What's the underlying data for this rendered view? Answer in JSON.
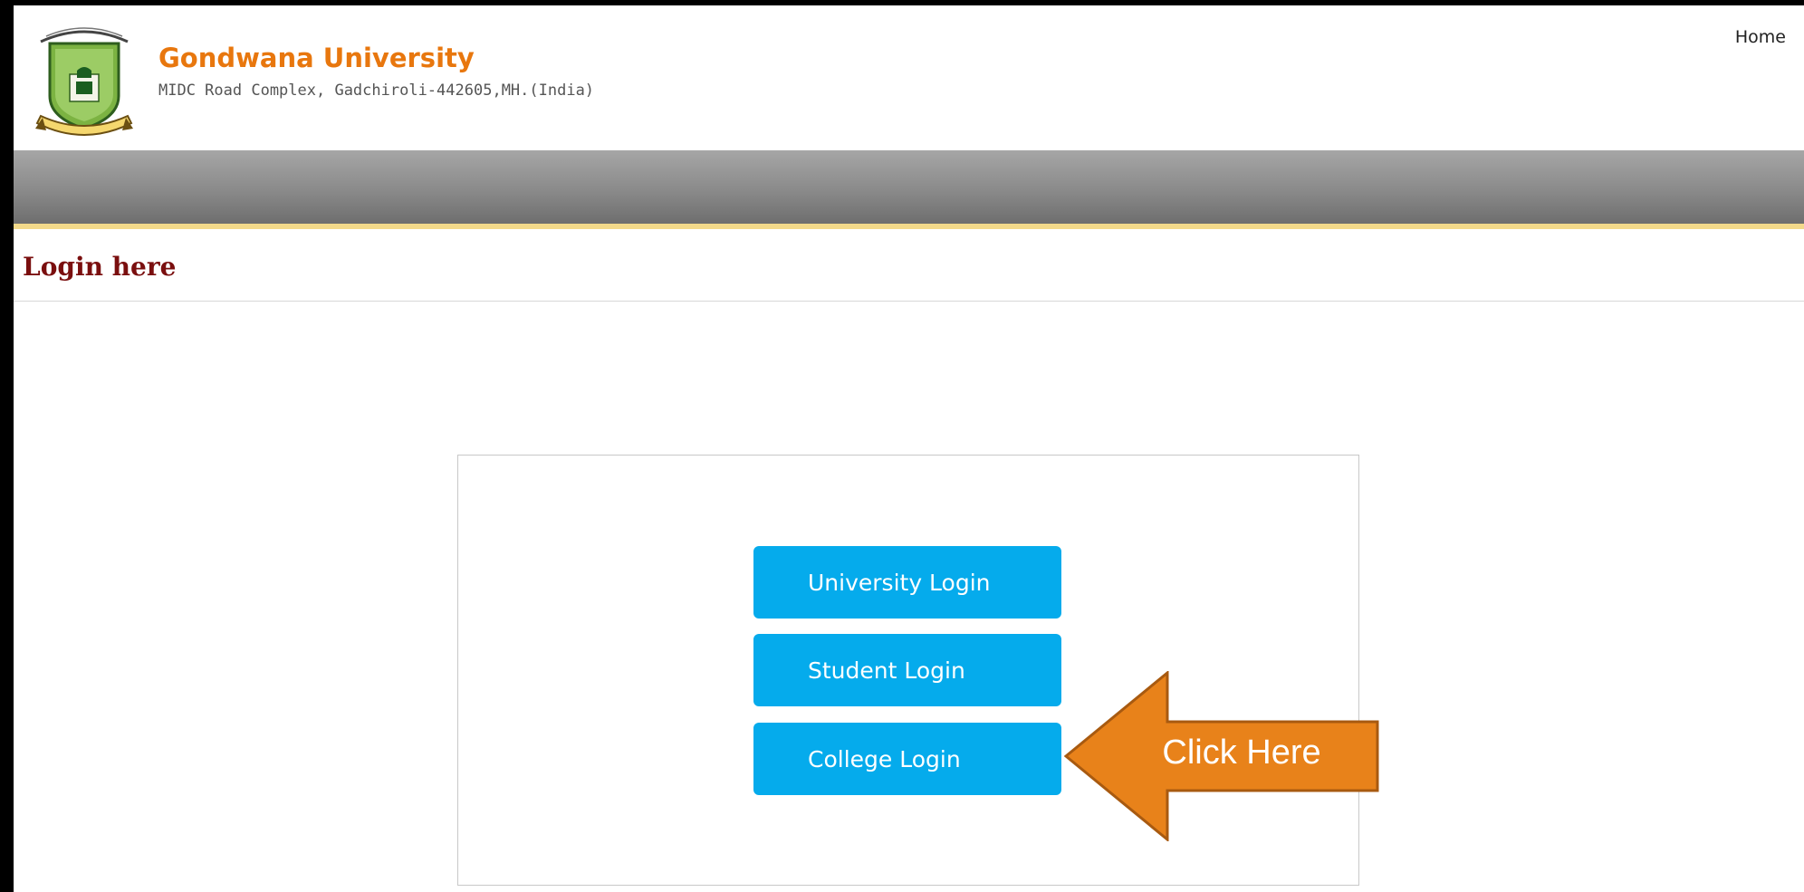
{
  "header": {
    "title": "Gondwana University",
    "address": "MIDC Road Complex, Gadchiroli-442605,MH.(India)",
    "home_link": "Home"
  },
  "section": {
    "heading": "Login here"
  },
  "login_panel": {
    "buttons": [
      {
        "label": "University Login"
      },
      {
        "label": "Student Login"
      },
      {
        "label": "College Login"
      }
    ]
  },
  "callout": {
    "text": "Click Here"
  },
  "colors": {
    "brand_orange": "#e8770e",
    "heading_maroon": "#7a0f0f",
    "button_blue": "#05abec",
    "callout_orange": "#e8821a"
  }
}
